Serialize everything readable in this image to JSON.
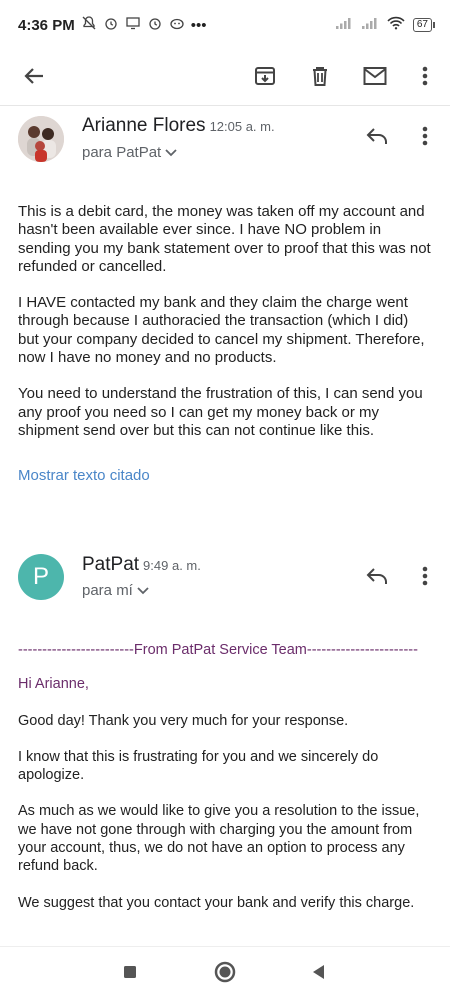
{
  "status_bar": {
    "time": "4:36 PM",
    "battery": "67"
  },
  "app_bar": {
    "back_icon": "arrow-back-icon",
    "archive_icon": "archive-icon",
    "delete_icon": "trash-icon",
    "mark_unread_icon": "mail-icon",
    "more_icon": "more-vert-icon"
  },
  "messages": [
    {
      "sender": "Arianne Flores",
      "time": "12:05 a. m.",
      "to": "para PatPat",
      "body": [
        "This is a debit card, the money was taken off my account and hasn't been available ever since. I have NO problem in sending you my bank statement over to proof that this was not refunded or cancelled.",
        "I HAVE contacted my bank and they claim the charge went through because I authoracied the transaction (which I did) but your company decided to cancel my shipment. Therefore, now I have no money and no products.",
        "You need to understand the frustration of this, I can send you any proof you need so I can get my money back or my shipment send over but this can not continue like this."
      ],
      "quoted_link": "Mostrar texto citado"
    },
    {
      "sender": "PatPat",
      "avatar_letter": "P",
      "time": "9:49 a. m.",
      "to": "para mí",
      "divider": "------------------------From PatPat Service Team-----------------------",
      "greeting": "Hi Arianne,",
      "body": [
        "Good day! Thank you very much for your response.",
        "I know that this is frustrating for you and we sincerely do apologize.",
        "As much as we would like to give you a resolution to the issue, we have not gone through with charging you the amount from your account, thus, we do not have an option to process any refund back.",
        "We suggest that you contact your bank and verify this charge."
      ]
    }
  ],
  "colors": {
    "accent_link": "#4a86c8",
    "patpat_avatar": "#4db6ac",
    "signature_purple": "#6b2d6b"
  }
}
